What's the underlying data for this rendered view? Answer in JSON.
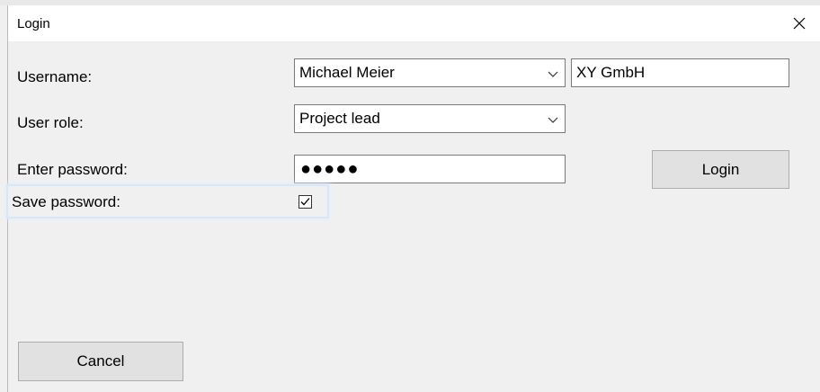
{
  "window": {
    "title": "Login"
  },
  "form": {
    "username_label": "Username:",
    "username_value": "Michael Meier",
    "company_value": "XY GmbH",
    "role_label": "User role:",
    "role_value": "Project lead",
    "password_label": "Enter password:",
    "password_mask": "●●●●●",
    "save_password_label": "Save password:",
    "save_password_checked": true
  },
  "buttons": {
    "login_label": "Login",
    "cancel_label": "Cancel"
  },
  "icons": {
    "close": "close-icon",
    "dropdown": "chevron-down-icon",
    "check": "check-icon"
  }
}
